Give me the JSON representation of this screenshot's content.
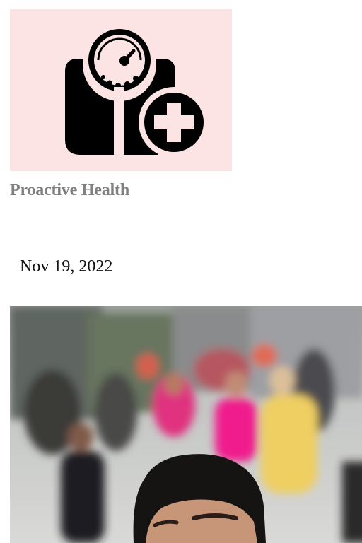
{
  "brand": {
    "name": "Proactive Health",
    "logo_icon": "scale-plus-icon",
    "logo_background": "#fde4e4",
    "logo_color": "#000000"
  },
  "post": {
    "date": "Nov 19, 2022",
    "hero_image": "street-crowd-selfie-photo"
  },
  "colors": {
    "brand_text": "#808080",
    "date_text": "#111111"
  }
}
